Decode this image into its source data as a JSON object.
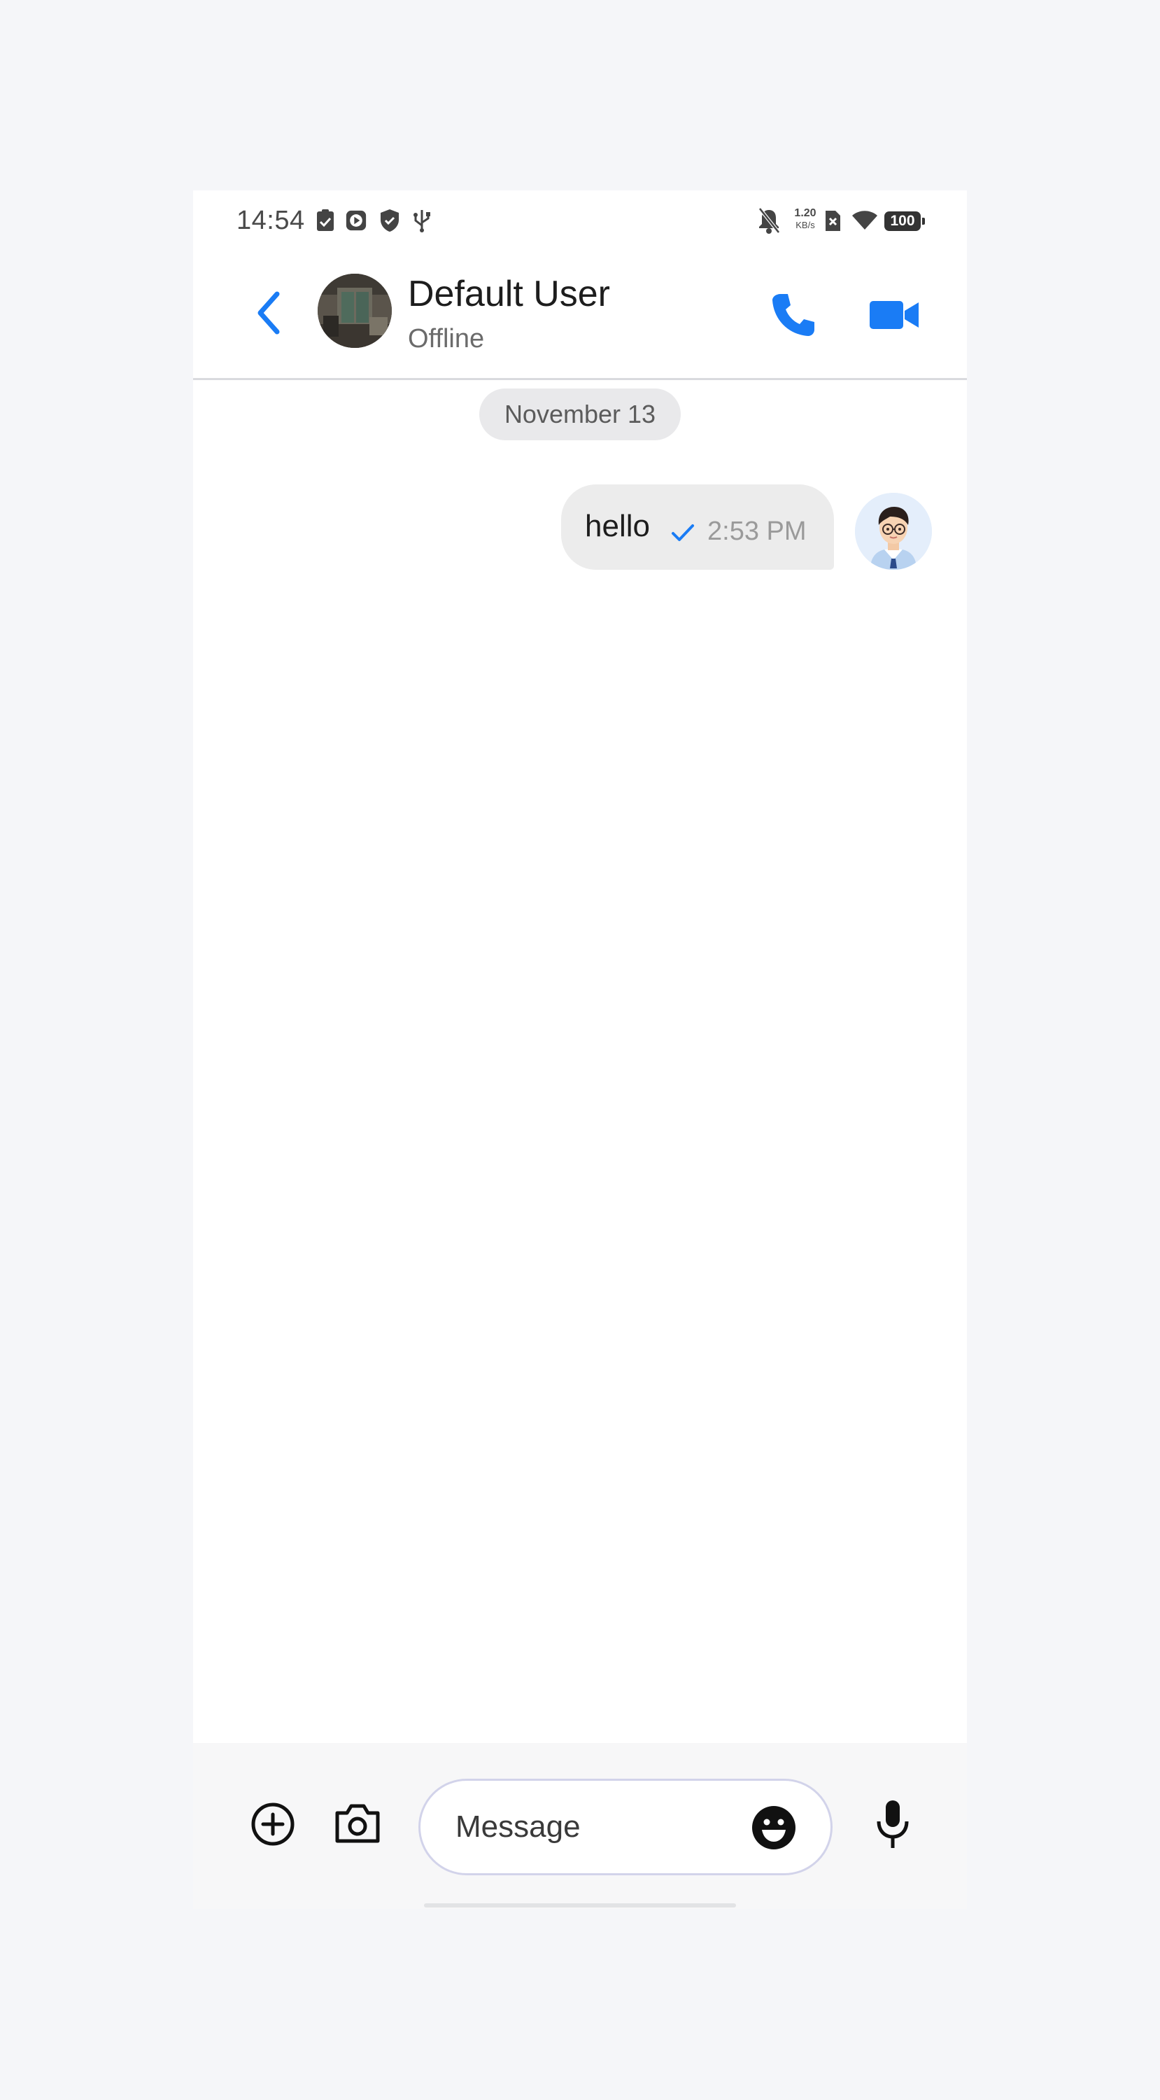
{
  "status_bar": {
    "time": "14:54",
    "net_speed_value": "1.20",
    "net_speed_unit": "KB/s",
    "battery": "100",
    "left_icons": [
      "clipboard-check-icon",
      "play-circle-icon",
      "shield-check-icon",
      "usb-icon"
    ],
    "right_icons": [
      "bell-off-icon",
      "sim-x-icon",
      "wifi-icon",
      "battery-icon"
    ]
  },
  "header": {
    "contact_name": "Default User",
    "contact_status": "Offline",
    "icons": [
      "chevron-left-icon",
      "phone-icon",
      "video-camera-icon"
    ]
  },
  "conversation": {
    "date_separator": "November 13",
    "messages": [
      {
        "text": "hello",
        "time": "2:53 PM",
        "status": "sent"
      }
    ]
  },
  "composer": {
    "placeholder": "Message",
    "icons": [
      "plus-circle-icon",
      "camera-icon",
      "smiley-icon",
      "microphone-icon"
    ]
  },
  "colors": {
    "accent": "#1a7cf5",
    "bubble": "#ececec",
    "date_chip": "#e9e9eb",
    "background": "#f5f6f9"
  }
}
